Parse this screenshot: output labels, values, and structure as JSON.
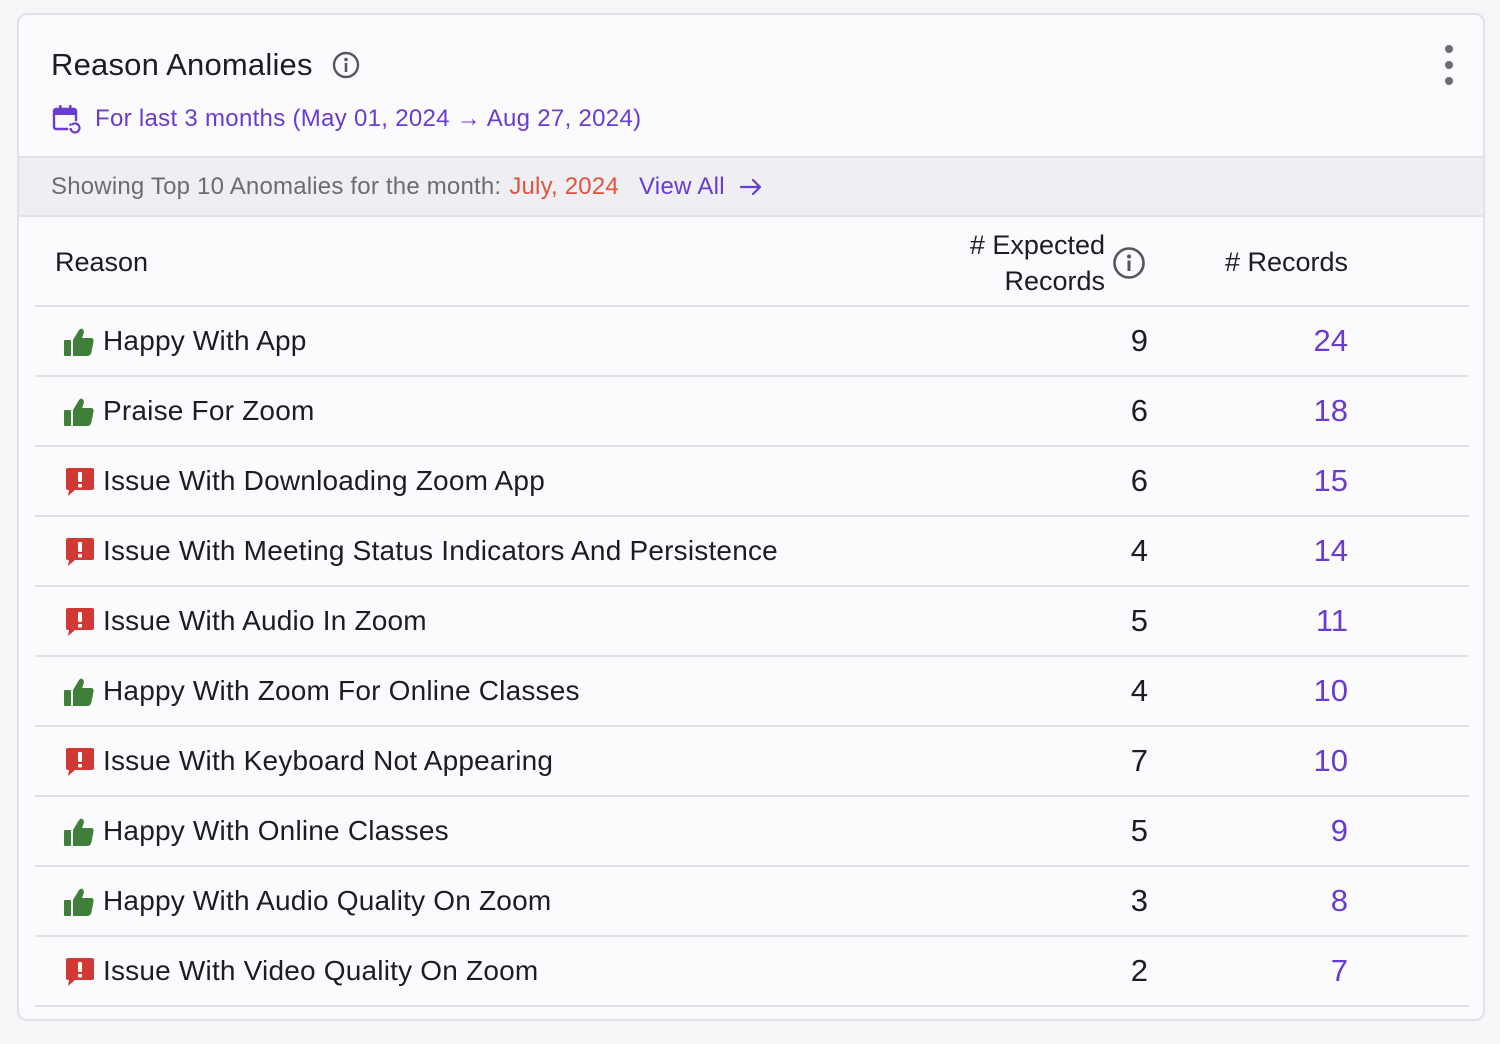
{
  "card": {
    "title": "Reason Anomalies",
    "date_range": "For last 3 months (May 01, 2024 → Aug 27, 2024)"
  },
  "banner": {
    "prefix": "Showing Top 10 Anomalies for the month:",
    "month": "July, 2024",
    "view_all": "View All"
  },
  "table": {
    "headers": {
      "reason": "Reason",
      "expected_line1": "# Expected",
      "expected_line2": "Records",
      "records": "# Records"
    },
    "rows": [
      {
        "type": "positive",
        "reason": "Happy With App",
        "expected": "9",
        "records": "24"
      },
      {
        "type": "positive",
        "reason": "Praise For Zoom",
        "expected": "6",
        "records": "18"
      },
      {
        "type": "issue",
        "reason": "Issue With Downloading Zoom App",
        "expected": "6",
        "records": "15"
      },
      {
        "type": "issue",
        "reason": "Issue With Meeting Status Indicators And Persistence",
        "expected": "4",
        "records": "14"
      },
      {
        "type": "issue",
        "reason": "Issue With Audio In Zoom",
        "expected": "5",
        "records": "11"
      },
      {
        "type": "positive",
        "reason": "Happy With Zoom For Online Classes",
        "expected": "4",
        "records": "10"
      },
      {
        "type": "issue",
        "reason": "Issue With Keyboard Not Appearing",
        "expected": "7",
        "records": "10"
      },
      {
        "type": "positive",
        "reason": "Happy With Online Classes",
        "expected": "5",
        "records": "9"
      },
      {
        "type": "positive",
        "reason": "Happy With Audio Quality On Zoom",
        "expected": "3",
        "records": "8"
      },
      {
        "type": "issue",
        "reason": "Issue With Video Quality On Zoom",
        "expected": "2",
        "records": "7"
      }
    ]
  },
  "icons": {
    "positive": "thumbs-up-icon",
    "issue": "alert-comment-icon"
  },
  "colors": {
    "accent": "#6a3bd0",
    "month": "#e0533f",
    "positive": "#3f7f3a",
    "issue": "#d13a34"
  }
}
